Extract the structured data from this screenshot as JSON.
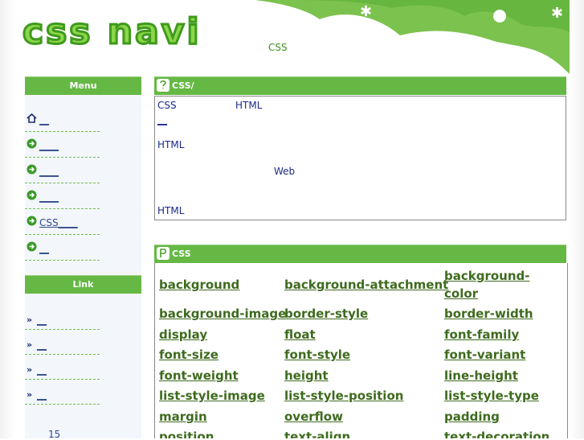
{
  "header": {
    "logo_text": "css navi",
    "tagline": "CSS"
  },
  "sidebar": {
    "menu_title": "Menu",
    "menu_items": [
      {
        "icon": "home-icon",
        "label": "__"
      },
      {
        "icon": "arrow-right-circle-icon",
        "label": "____"
      },
      {
        "icon": "arrow-right-circle-icon",
        "label": "____"
      },
      {
        "icon": "arrow-right-circle-icon",
        "label": "____"
      },
      {
        "icon": "arrow-right-circle-icon",
        "label": "CSS____"
      },
      {
        "icon": "arrow-right-circle-icon",
        "label": "__"
      }
    ],
    "link_title": "Link",
    "link_items": [
      {
        "icon": "double-chevron-icon",
        "label": "__"
      },
      {
        "icon": "double-chevron-icon",
        "label": "__"
      },
      {
        "icon": "double-chevron-icon",
        "label": "__"
      },
      {
        "icon": "double-chevron-icon",
        "label": "__"
      }
    ],
    "counter": "15"
  },
  "intro": {
    "title": "CSS/",
    "lines": [
      "CSS",
      "HTML",
      "__",
      "HTML",
      "Web",
      "HTML"
    ]
  },
  "properties": {
    "title": "CSS",
    "items": [
      "background",
      "background-attachment",
      "background-color",
      "background-image",
      "border-style",
      "border-width",
      "display",
      "float",
      "font-family",
      "font-size",
      "font-style",
      "font-variant",
      "font-weight",
      "height",
      "line-height",
      "list-style-image",
      "list-style-position",
      "list-style-type",
      "margin",
      "overflow",
      "padding",
      "position",
      "text-align",
      "text-decoration"
    ]
  },
  "colors": {
    "accent_green": "#66b845",
    "logo_green": "#8bd64a",
    "link_green": "#3e6b1e",
    "text_blue": "#1b2a8a"
  }
}
